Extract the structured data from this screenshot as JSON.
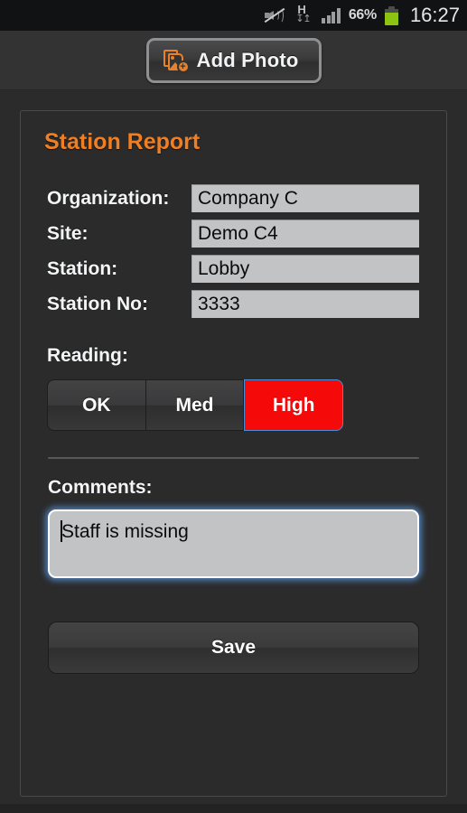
{
  "statusbar": {
    "network_type": "H",
    "battery_percent": "66%",
    "clock": "16:27",
    "icons": {
      "mute": "mute-speaker-icon",
      "data": "hspa-data-icon",
      "signal": "signal-bars-icon",
      "battery": "battery-icon"
    }
  },
  "topbar": {
    "add_photo_label": "Add Photo",
    "add_photo_icon": "add-photo-icon"
  },
  "page": {
    "title": "Station Report"
  },
  "form": {
    "fields": [
      {
        "label": "Organization:",
        "value": "Company C"
      },
      {
        "label": "Site:",
        "value": "Demo C4"
      },
      {
        "label": "Station:",
        "value": "Lobby"
      },
      {
        "label": "Station No:",
        "value": "3333"
      }
    ]
  },
  "reading": {
    "label": "Reading:",
    "options": [
      {
        "label": "OK",
        "selected": false
      },
      {
        "label": "Med",
        "selected": false
      },
      {
        "label": "High",
        "selected": true
      }
    ],
    "selected_value": "High",
    "selected_color": "#f60909"
  },
  "comments": {
    "label": "Comments:",
    "value": "Staff is missing",
    "placeholder": "",
    "focused": true
  },
  "actions": {
    "save_label": "Save"
  },
  "theme": {
    "accent": "#ef7f22",
    "danger": "#f60909",
    "focus": "#5a96dc",
    "background": "#2b2b2b",
    "field_background": "#c2c3c4"
  }
}
